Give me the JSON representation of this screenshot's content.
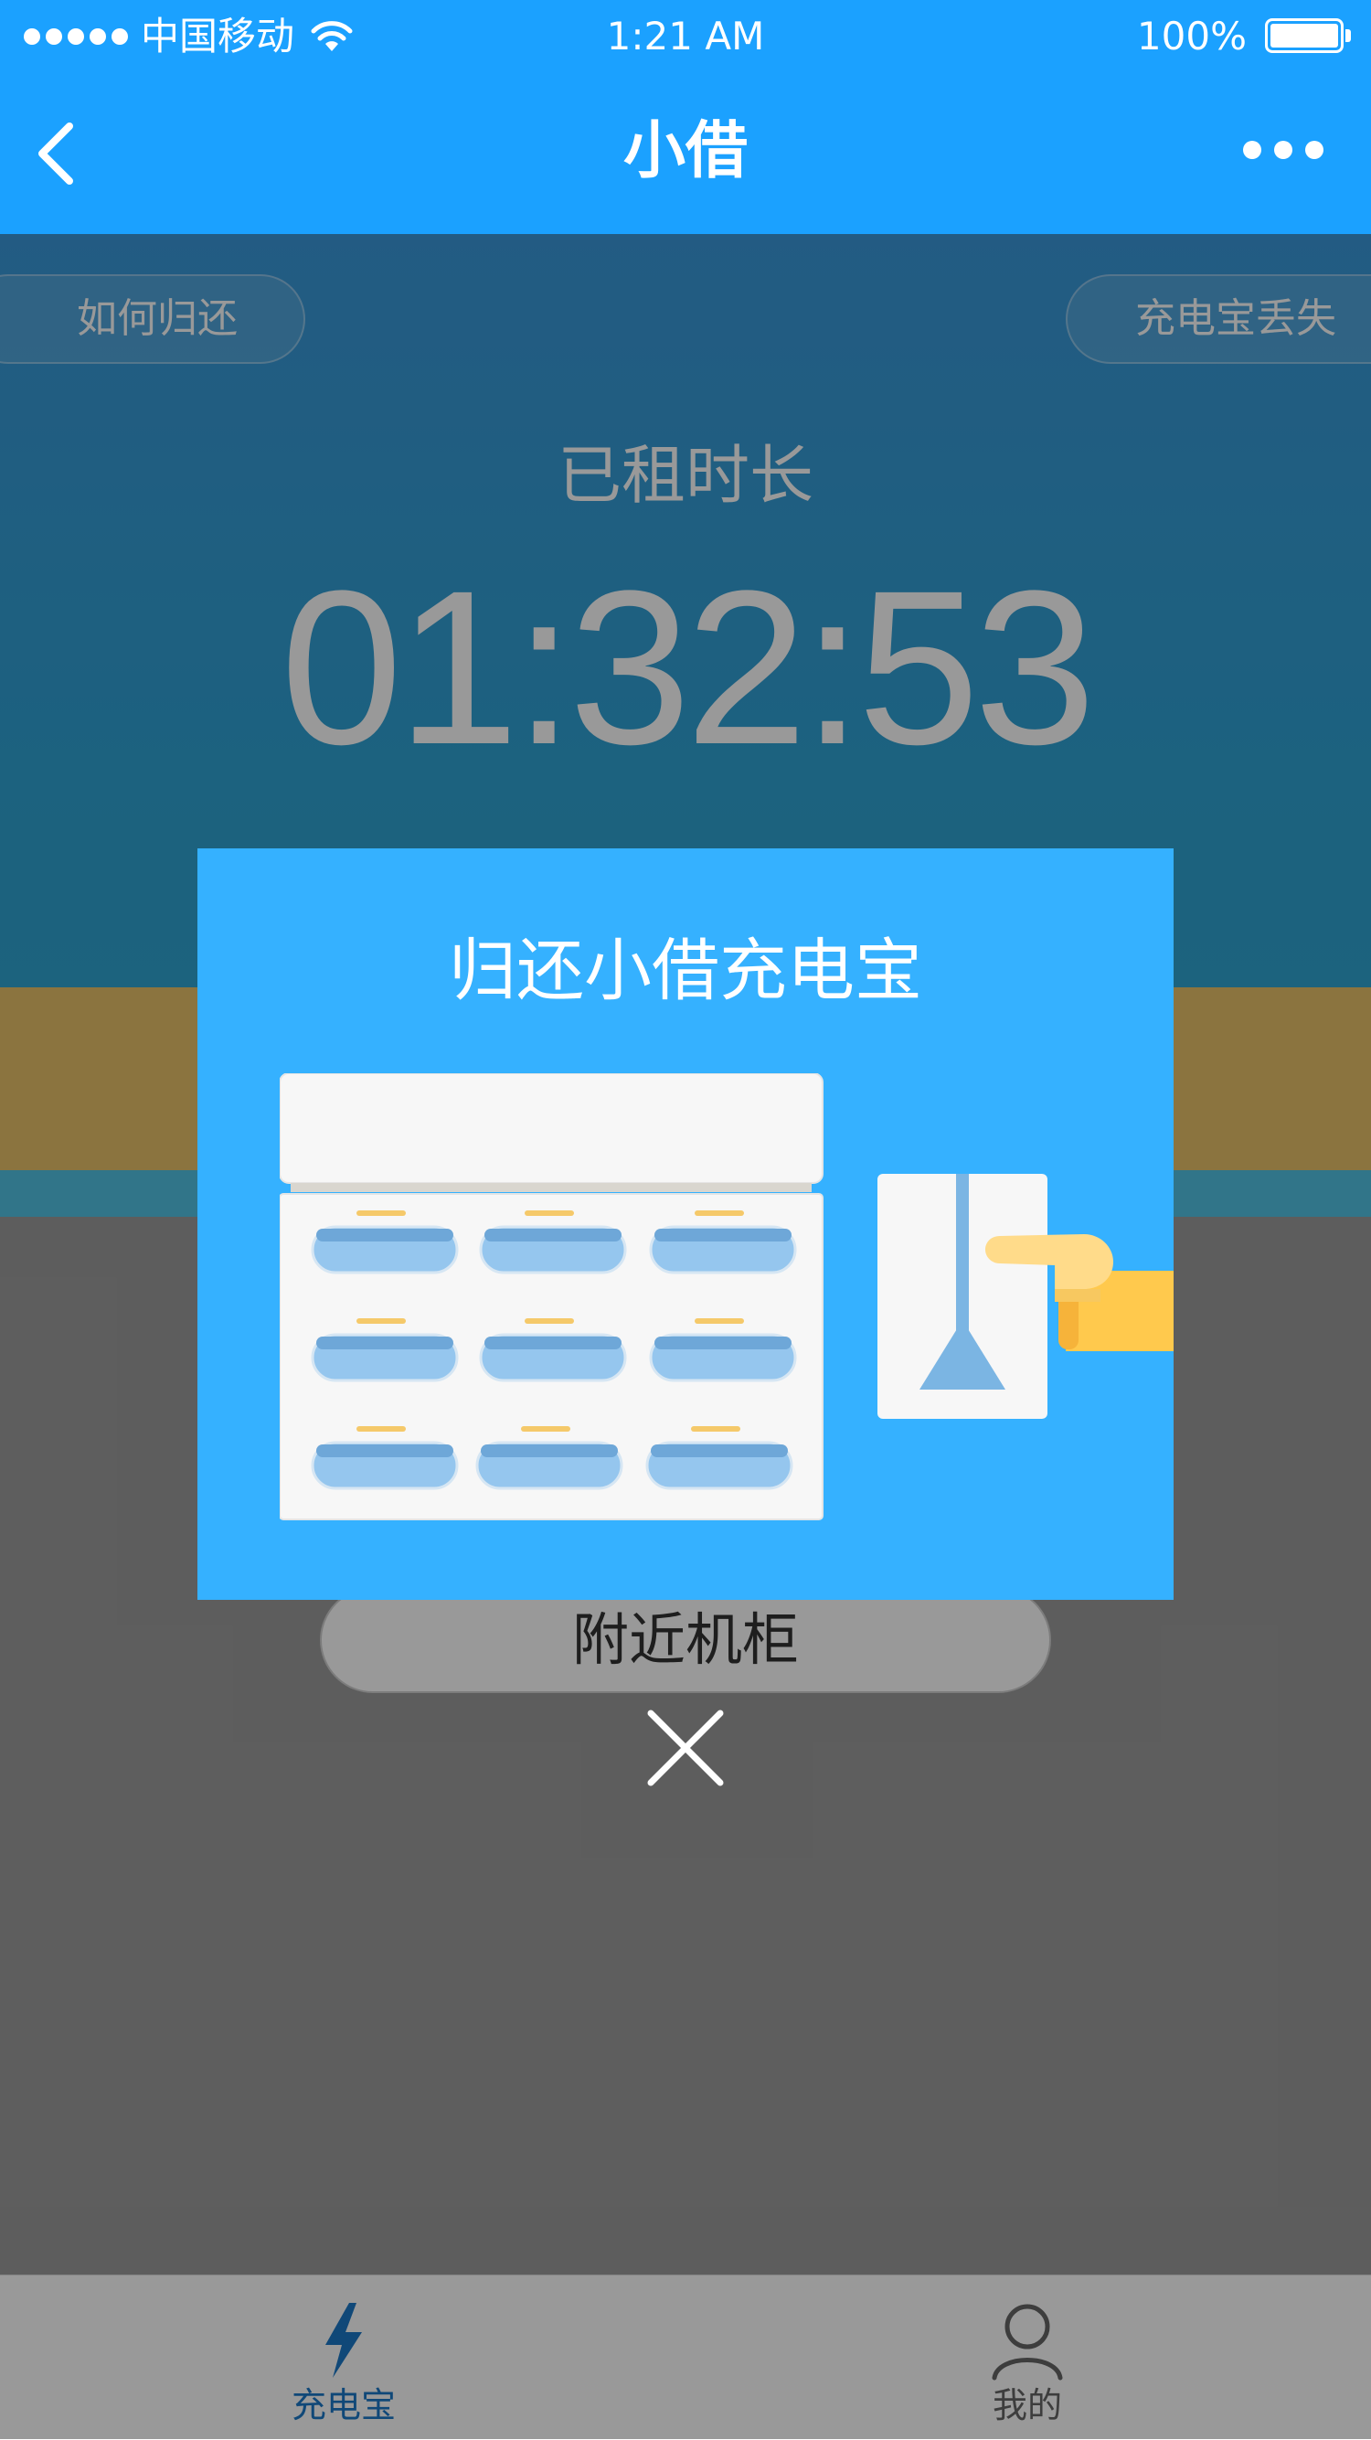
{
  "status_bar": {
    "carrier": "中国移动",
    "time": "1:21 AM",
    "battery": "100%",
    "icons": [
      "signal-dots-icon",
      "wifi-icon",
      "battery-icon"
    ]
  },
  "nav": {
    "title": "小借",
    "back_icon": "chevron-left-icon",
    "more_icon": "ellipsis-icon"
  },
  "hero": {
    "how_to_return": "如何归还",
    "lost_powerbank": "充电宝丢失",
    "rent_duration_label": "已租时长",
    "timer": "01:32:53"
  },
  "nearby_button": "附近机柜",
  "modal": {
    "title": "归还小借充电宝",
    "illustration": "return-powerbank-illustration",
    "close_icon": "close-icon"
  },
  "tabs": [
    {
      "label": "充电宝",
      "icon": "lightning-icon",
      "active": true
    },
    {
      "label": "我的",
      "icon": "user-icon",
      "active": false
    }
  ],
  "colors": {
    "brand_blue": "#1ba1ff",
    "modal_blue": "#35b1ff",
    "active_tab": "#1c78c8",
    "accent_yellow": "#ffd060"
  }
}
